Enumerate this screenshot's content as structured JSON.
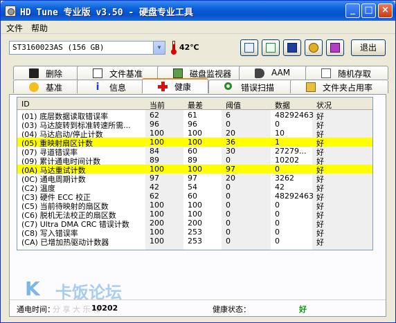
{
  "window": {
    "title": "HD Tune 专业版 v3.50 - 硬盘专业工具"
  },
  "menu": [
    "文件",
    "帮助"
  ],
  "toolbar": {
    "drive": "ST3160023AS (156 GB)",
    "temperature": "42℃",
    "exit_label": "退出"
  },
  "tabs_row1": [
    "删除",
    "文件基准",
    "磁盘监视器",
    "AAM",
    "随机存取"
  ],
  "tabs_row2": [
    "基准",
    "信息",
    "健康",
    "错误扫描",
    "文件夹占用率"
  ],
  "active_tab": "健康",
  "table": {
    "headers": [
      "ID",
      "当前",
      "最差",
      "阈值",
      "数据",
      "状况"
    ],
    "rows": [
      {
        "id": "(01) 底层数据读取错误率",
        "cur": "62",
        "worst": "61",
        "thr": "6",
        "data": "48292463",
        "status": "好",
        "highlight": false
      },
      {
        "id": "(03) 马达旋转到标准转速所需...",
        "cur": "96",
        "worst": "96",
        "thr": "0",
        "data": "0",
        "status": "好",
        "highlight": false
      },
      {
        "id": "(04) 马达启动/停止计数",
        "cur": "100",
        "worst": "100",
        "thr": "20",
        "data": "10",
        "status": "好",
        "highlight": false
      },
      {
        "id": "(05) 重映射扇区计数",
        "cur": "100",
        "worst": "100",
        "thr": "36",
        "data": "1",
        "status": "好",
        "highlight": true
      },
      {
        "id": "(07) 寻道错误率",
        "cur": "84",
        "worst": "60",
        "thr": "30",
        "data": "27279...",
        "status": "好",
        "highlight": false
      },
      {
        "id": "(09) 累计通电时间计数",
        "cur": "89",
        "worst": "89",
        "thr": "0",
        "data": "10202",
        "status": "好",
        "highlight": false
      },
      {
        "id": "(0A) 马达重试计数",
        "cur": "100",
        "worst": "100",
        "thr": "97",
        "data": "0",
        "status": "好",
        "highlight": true
      },
      {
        "id": "(0C) 通电周期计数",
        "cur": "97",
        "worst": "97",
        "thr": "20",
        "data": "3262",
        "status": "好",
        "highlight": false
      },
      {
        "id": "(C2) 温度",
        "cur": "42",
        "worst": "54",
        "thr": "0",
        "data": "42",
        "status": "好",
        "highlight": false
      },
      {
        "id": "(C3) 硬件 ECC 校正",
        "cur": "62",
        "worst": "60",
        "thr": "0",
        "data": "48292463",
        "status": "好",
        "highlight": false
      },
      {
        "id": "(C5) 当前待映射的扇区数",
        "cur": "100",
        "worst": "100",
        "thr": "0",
        "data": "0",
        "status": "好",
        "highlight": false
      },
      {
        "id": "(C6) 脱机无法校正的扇区数",
        "cur": "100",
        "worst": "100",
        "thr": "0",
        "data": "0",
        "status": "好",
        "highlight": false
      },
      {
        "id": "(C7) Ultra DMA CRC 错误计数",
        "cur": "200",
        "worst": "200",
        "thr": "0",
        "data": "0",
        "status": "好",
        "highlight": false
      },
      {
        "id": "(C8) 写入错误率",
        "cur": "100",
        "worst": "253",
        "thr": "0",
        "data": "0",
        "status": "好",
        "highlight": false
      },
      {
        "id": "(CA) 已增加热驱动计数器",
        "cur": "100",
        "worst": "253",
        "thr": "0",
        "data": "0",
        "status": "好",
        "highlight": false
      }
    ]
  },
  "watermark": {
    "logo": "K",
    "text": "卡饭论坛",
    "sub": "分 享  大  乐 和"
  },
  "footer": {
    "power_on_label": "通电时间：",
    "power_on_value": "10202",
    "health_label": "健康状态：",
    "health_value": "好"
  },
  "colors": {
    "highlight": "#ffff00",
    "health_good": "#00a000",
    "active_tab_accent": "#e68b2c"
  }
}
